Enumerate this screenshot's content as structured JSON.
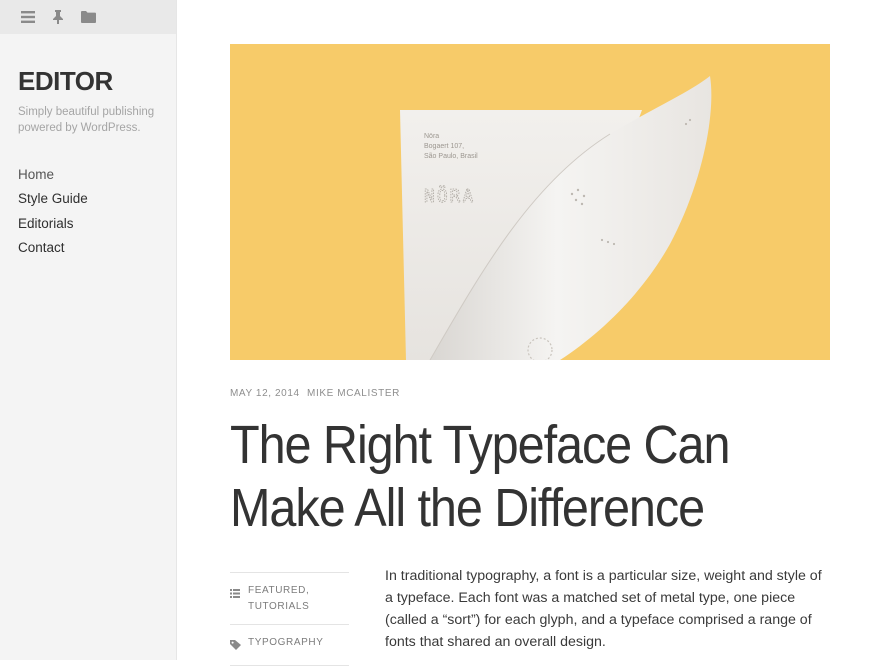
{
  "sidebar": {
    "toolbar": {
      "menu_icon": "hamburger-icon",
      "pin_icon": "pin-icon",
      "folder_icon": "folder-icon"
    },
    "site_title": "EDITOR",
    "site_description": "Simply beautiful publishing powered by WordPress.",
    "nav": [
      "Home",
      "Style Guide",
      "Editorials",
      "Contact"
    ]
  },
  "hero": {
    "letterhead_name": "Nöra",
    "letterhead_address_1": "Bogaert 107,",
    "letterhead_address_2": "São Paulo, Brasil",
    "letterhead_logo": "NÖRA",
    "background": "#f7cb69"
  },
  "post": {
    "date": "MAY 12, 2014",
    "author": "MIKE MCALISTER",
    "title_line_1": "The Right Typeface Can",
    "title_line_2": "Make All the Difference",
    "categories_1": "FEATURED,",
    "categories_2": "TUTORIALS",
    "tags": "TYPOGRAPHY",
    "body": "In traditional typography, a font is a particular size, weight and style of a typeface. Each font was a matched set of metal type, one piece (called a “sort”) for each glyph, and a typeface comprised a range of fonts that shared an overall design."
  }
}
